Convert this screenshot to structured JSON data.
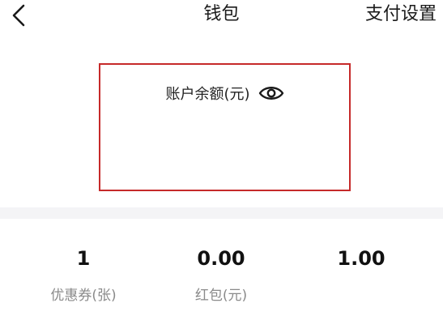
{
  "header": {
    "back_icon": "chevron-left-icon",
    "title": "钱包",
    "settings_label": "支付设置"
  },
  "balance": {
    "label": "账户余额(元)",
    "visibility_icon": "eye-icon",
    "highlight_color": "#c62a2a"
  },
  "stats": [
    {
      "value": "1",
      "label": "优惠券(张)"
    },
    {
      "value": "0.00",
      "label": "红包(元)"
    },
    {
      "value": "1.00",
      "label": ""
    }
  ]
}
